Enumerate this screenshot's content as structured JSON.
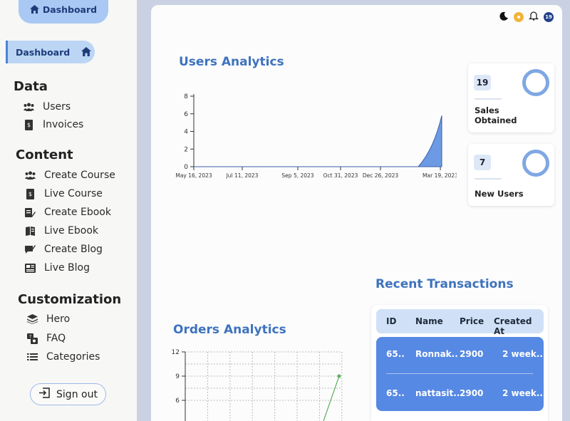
{
  "sidebar": {
    "top_tab": "Dashboard",
    "active": "Dashboard",
    "sections": [
      {
        "title": "Data",
        "items": [
          "Users",
          "Invoices"
        ]
      },
      {
        "title": "Content",
        "items": [
          "Create Course",
          "Live Course",
          "Create Ebook",
          "Live Ebook",
          "Create Blog",
          "Live Blog"
        ]
      },
      {
        "title": "Customization",
        "items": [
          "Hero",
          "FAQ",
          "Categories"
        ]
      }
    ],
    "signout": "Sign out"
  },
  "header": {
    "notification_count": "19"
  },
  "users_analytics": {
    "title": "Users Analytics",
    "chart_data": {
      "type": "area",
      "x": [
        "May 16, 2023",
        "Jul 11, 2023",
        "Sep 5, 2023",
        "Oct 31, 2023",
        "Dec 26, 2023",
        "Mar 19, 2023"
      ],
      "values": [
        0,
        0,
        0,
        0,
        0,
        5.8
      ],
      "ylim": [
        0,
        8
      ],
      "yticks": [
        "0",
        "2",
        "4",
        "6",
        "8"
      ],
      "grid": false,
      "color": "#6d9ae4"
    }
  },
  "stats": [
    {
      "value": "19",
      "label_1": "Sales",
      "label_2": "Obtained"
    },
    {
      "value": "7",
      "label_1": "New Users",
      "label_2": ""
    }
  ],
  "transactions": {
    "title": "Recent Transactions",
    "columns": [
      "ID",
      "Name",
      "Price",
      "Created At"
    ],
    "rows": [
      {
        "id": "65..",
        "name": "Ronnak..",
        "price": "2900",
        "created": "2 week.."
      },
      {
        "id": "65..",
        "name": "nattasit..",
        "price": "2900",
        "created": "2 week.."
      }
    ]
  },
  "orders_analytics": {
    "title": "Orders Analytics",
    "chart_data": {
      "type": "line",
      "yticks": [
        "6",
        "9",
        "12"
      ],
      "ylim": [
        6,
        12
      ],
      "grid": true,
      "visible_points": [
        {
          "y": 9
        }
      ],
      "color": "#5fae5f"
    }
  },
  "colors": {
    "accent": "#3e73bd",
    "sidebar_active": "#bcd5f5",
    "table_body": "#5689e3"
  }
}
